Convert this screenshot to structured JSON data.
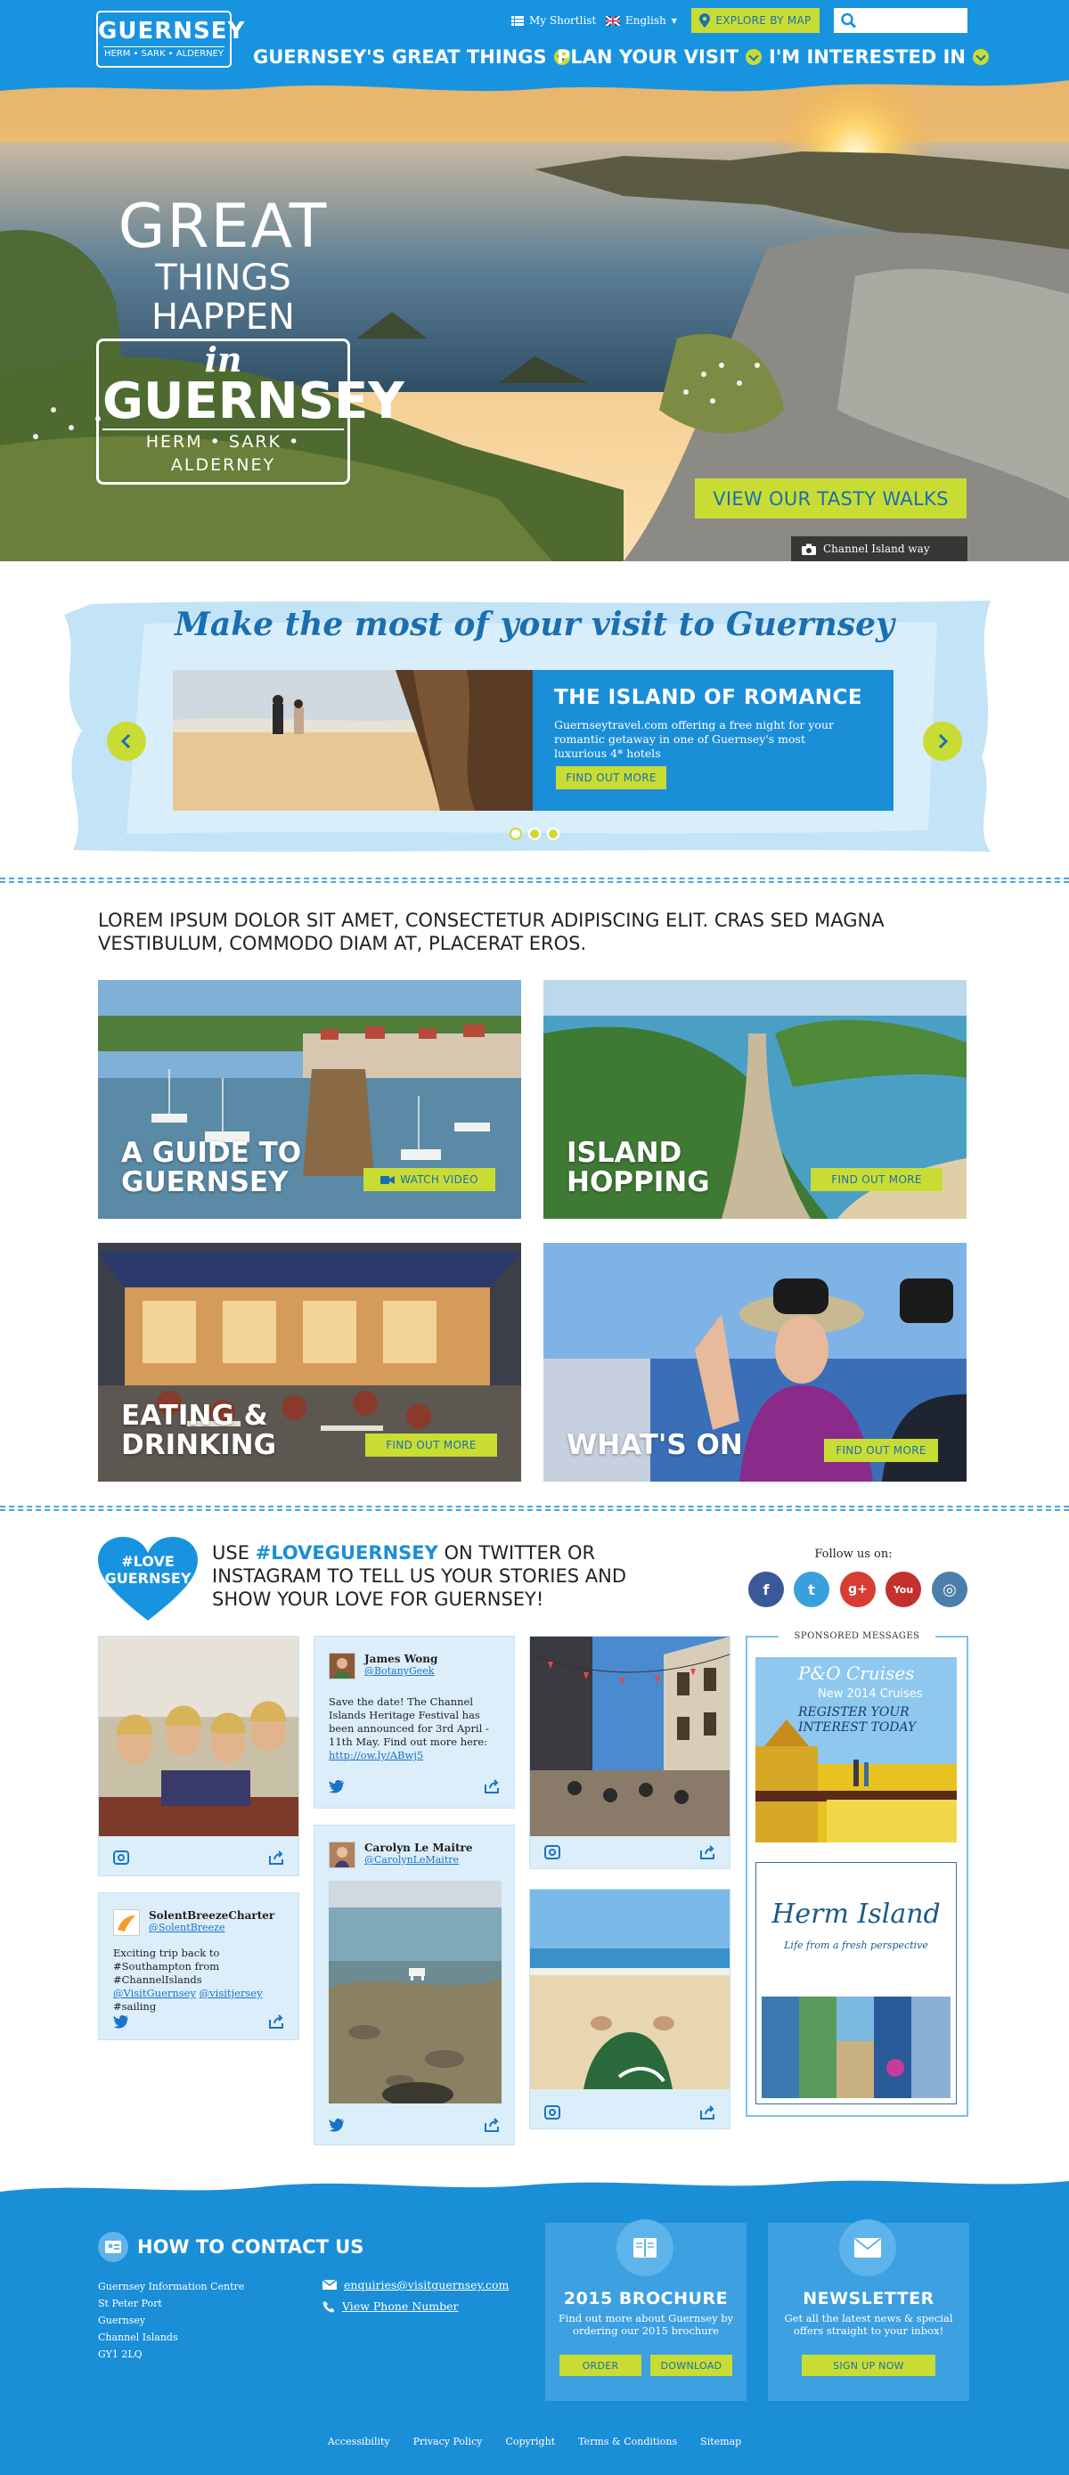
{
  "header": {
    "logo_main": "GUERNSEY",
    "logo_sub": "HERM • SARK • ALDERNEY",
    "shortlist_label": "My Shortlist",
    "language_label": "English",
    "explore_label": "EXPLORE BY MAP",
    "search_placeholder": "",
    "nav": [
      {
        "label": "GUERNSEY'S GREAT THINGS"
      },
      {
        "label": "PLAN YOUR VISIT"
      },
      {
        "label": "I'M INTERESTED IN"
      }
    ],
    "colors": {
      "brand_blue": "#1893e0",
      "accent_lime": "#c8dc33"
    }
  },
  "hero": {
    "title_line1": "GREAT",
    "title_line2": "THINGS HAPPEN",
    "title_in": "in",
    "title_brand": "GUERNSEY",
    "title_sub": "HERM • SARK • ALDERNEY",
    "cta_label": "VIEW OUR TASTY WALKS",
    "caption": "Channel Island way"
  },
  "carousel": {
    "heading": "Make the most of your visit to Guernsey",
    "slide_title": "THE ISLAND OF ROMANCE",
    "slide_text": "Guernseytravel.com offering a free night for your romantic getaway in one of Guernsey's most luxurious 4* hotels",
    "slide_button": "FIND OUT MORE"
  },
  "intro": {
    "text": "LOREM IPSUM DOLOR SIT AMET, CONSECTETUR ADIPISCING ELIT. CRAS SED MAGNA VESTIBULUM, COMMODO DIAM AT, PLACERAT EROS."
  },
  "tiles": [
    {
      "line1": "A GUIDE TO",
      "line2": "GUERNSEY",
      "button": "WATCH VIDEO"
    },
    {
      "line1": "ISLAND",
      "line2": "HOPPING",
      "button": "FIND OUT MORE"
    },
    {
      "line1": "EATING &",
      "line2": "DRINKING",
      "button": "FIND OUT MORE"
    },
    {
      "line1": "",
      "line2": "WHAT'S ON",
      "button": "FIND OUT MORE"
    }
  ],
  "social": {
    "heart_line1": "#LOVE",
    "heart_line2": "GUERNSEY",
    "text_pre": "USE ",
    "hashtag": "#LOVEGUERNSEY",
    "text_post": " ON TWITTER OR INSTAGRAM TO TELL US YOUR STORIES AND SHOW YOUR LOVE FOR GUERNSEY!",
    "follow_label": "Follow us on:",
    "networks": [
      {
        "icon": "facebook-icon",
        "glyph": "f",
        "color": "#3b5998"
      },
      {
        "icon": "twitter-icon",
        "glyph": "t",
        "color": "#3aa0dd"
      },
      {
        "icon": "google-plus-icon",
        "glyph": "g+",
        "color": "#d73d32"
      },
      {
        "icon": "youtube-icon",
        "glyph": "You",
        "color": "#c4302b"
      },
      {
        "icon": "instagram-icon",
        "glyph": "◎",
        "color": "#4b7ea8"
      }
    ],
    "tweets": [
      {
        "name": "James Wong",
        "handle": "@BotanyGeek",
        "text": "Save the date! The Channel Islands Heritage Festival has been announced for 3rd April - 11th May. Find out more here: ",
        "link": "http://ow.ly/ABwj5"
      },
      {
        "name": "SolentBreezeCharter",
        "handle": "@SolentBreeze",
        "text_a": "Exciting trip back to #Southampton from #ChannelIslands ",
        "mention1": "@VisitGuernsey",
        "mention2": "@visitjersey",
        "text_b": " #sailing"
      },
      {
        "name": "Carolyn Le Maitre",
        "handle": "@CarolynLeMaitre"
      }
    ],
    "sponsored_label": "SPONSORED MESSAGES",
    "ad1_brand": "P&O Cruises",
    "ad1_line1": "New 2014 Cruises",
    "ad1_line2": "REGISTER YOUR",
    "ad1_line3": "INTEREST TODAY",
    "ad2_title": "Herm Island",
    "ad2_sub": "Life from a fresh perspective"
  },
  "footer": {
    "contact_title": "HOW TO CONTACT US",
    "address": [
      "Guernsey Information Centre",
      "St Peter Port",
      "Guernsey",
      "Channel Islands",
      "GY1 2LQ"
    ],
    "email": "enquiries@visitguernsey.com",
    "phone_label": "View Phone Number",
    "brochure_title": "2015 BROCHURE",
    "brochure_text": "Find out more about Guernsey by ordering our 2015 brochure",
    "order_label": "ORDER",
    "download_label": "DOWNLOAD",
    "newsletter_title": "NEWSLETTER",
    "newsletter_text": "Get all the latest news & special offers straight to your inbox!",
    "signup_label": "SIGN UP NOW",
    "legal_links": [
      "Accessibility",
      "Privacy Policy",
      "Copyright",
      "Terms & Conditions",
      "Sitemap"
    ]
  }
}
